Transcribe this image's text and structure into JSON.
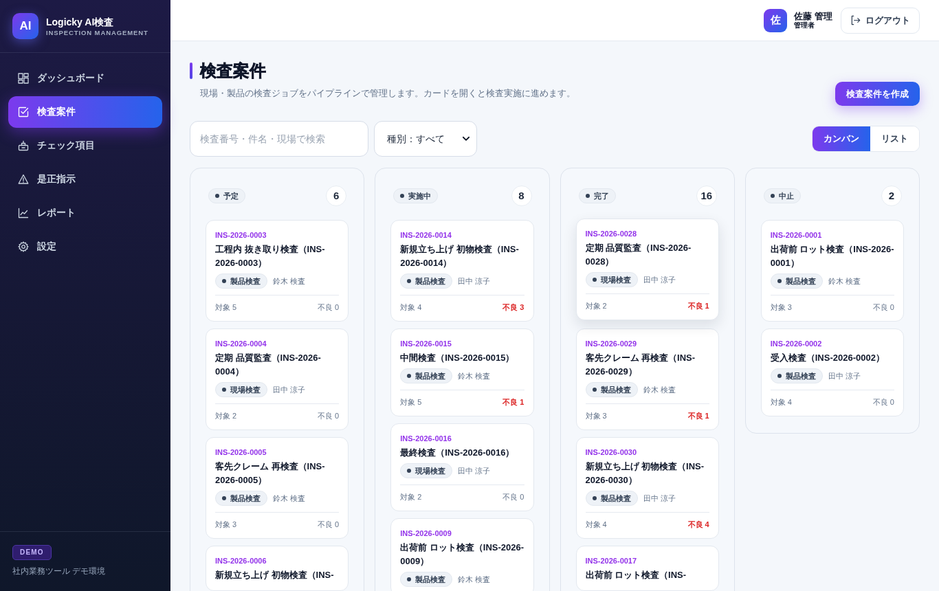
{
  "sidebar": {
    "logo": "AI",
    "title": "Logicky AI検査",
    "subtitle": "INSPECTION MANAGEMENT",
    "items": [
      {
        "label": "ダッシュボード",
        "selected": false
      },
      {
        "label": "検査案件",
        "selected": true
      },
      {
        "label": "チェック項目",
        "selected": false
      },
      {
        "label": "是正指示",
        "selected": false
      },
      {
        "label": "レポート",
        "selected": false
      },
      {
        "label": "設定",
        "selected": false
      }
    ],
    "badge": "DEMO",
    "note": "社内業務ツール デモ環境"
  },
  "header": {
    "user": {
      "avatar": "佐",
      "name": "佐藤 管理",
      "role": "管理者"
    },
    "logout": "ログアウト"
  },
  "page": {
    "title": "検査案件",
    "description": "現場・製品の検査ジョブをパイプラインで管理します。カードを開くと検査実施に進めます。",
    "create_button": "検査案件を作成"
  },
  "filters": {
    "search": {
      "placeholder": "検査番号・件名・現場で検索"
    },
    "type": {
      "value": "種別：すべて"
    }
  },
  "view_toggle": [
    {
      "label": "カンバン",
      "selected": true
    },
    {
      "label": "リスト",
      "selected": false
    }
  ],
  "board": {
    "columns": [
      {
        "status": "予定",
        "count": "6",
        "cards": [
          {
            "id": "INS-2026-0003",
            "title": "工程内 抜き取り検査（INS-2026-0003）",
            "tag": "製品検査",
            "assignee": "鈴木 検査",
            "target": "対象 5",
            "defects": "不良 0",
            "alert": false,
            "hovered": false
          },
          {
            "id": "INS-2026-0004",
            "title": "定期 品質監査（INS-2026-0004）",
            "tag": "現場検査",
            "assignee": "田中 涼子",
            "target": "対象 2",
            "defects": "不良 0",
            "alert": false,
            "hovered": false
          },
          {
            "id": "INS-2026-0005",
            "title": "客先クレーム 再検査（INS-2026-0005）",
            "tag": "製品検査",
            "assignee": "鈴木 検査",
            "target": "対象 3",
            "defects": "不良 0",
            "alert": false,
            "hovered": false
          },
          {
            "id": "INS-2026-0006",
            "title": "新規立ち上げ 初物検査（INS-",
            "hovered": false
          }
        ]
      },
      {
        "status": "実施中",
        "count": "8",
        "cards": [
          {
            "id": "INS-2026-0014",
            "title": "新規立ち上げ 初物検査（INS-2026-0014）",
            "tag": "製品検査",
            "assignee": "田中 涼子",
            "target": "対象 4",
            "defects": "不良 3",
            "alert": true,
            "hovered": false
          },
          {
            "id": "INS-2026-0015",
            "title": "中間検査（INS-2026-0015）",
            "tag": "製品検査",
            "assignee": "鈴木 検査",
            "target": "対象 5",
            "defects": "不良 1",
            "alert": true,
            "hovered": false
          },
          {
            "id": "INS-2026-0016",
            "title": "最終検査（INS-2026-0016）",
            "tag": "現場検査",
            "assignee": "田中 涼子",
            "target": "対象 2",
            "defects": "不良 0",
            "alert": false,
            "hovered": false
          },
          {
            "id": "INS-2026-0009",
            "title": "出荷前 ロット検査（INS-2026-0009）",
            "tag": "製品検査",
            "assignee": "鈴木 検査",
            "hovered": false
          }
        ]
      },
      {
        "status": "完了",
        "count": "16",
        "cards": [
          {
            "id": "INS-2026-0028",
            "title": "定期 品質監査（INS-2026-0028）",
            "tag": "現場検査",
            "assignee": "田中 涼子",
            "target": "対象 2",
            "defects": "不良 1",
            "alert": true,
            "hovered": true
          },
          {
            "id": "INS-2026-0029",
            "title": "客先クレーム 再検査（INS-2026-0029）",
            "tag": "製品検査",
            "assignee": "鈴木 検査",
            "target": "対象 3",
            "defects": "不良 1",
            "alert": true,
            "hovered": false
          },
          {
            "id": "INS-2026-0030",
            "title": "新規立ち上げ 初物検査（INS-2026-0030）",
            "tag": "製品検査",
            "assignee": "田中 涼子",
            "target": "対象 4",
            "defects": "不良 4",
            "alert": true,
            "hovered": false
          },
          {
            "id": "INS-2026-0017",
            "title": "出荷前 ロット検査（INS-",
            "hovered": false
          }
        ]
      },
      {
        "status": "中止",
        "count": "2",
        "cards": [
          {
            "id": "INS-2026-0001",
            "title": "出荷前 ロット検査（INS-2026-0001）",
            "tag": "製品検査",
            "assignee": "鈴木 検査",
            "target": "対象 3",
            "defects": "不良 0",
            "alert": false,
            "hovered": false
          },
          {
            "id": "INS-2026-0002",
            "title": "受入検査（INS-2026-0002）",
            "tag": "製品検査",
            "assignee": "田中 涼子",
            "target": "対象 4",
            "defects": "不良 0",
            "alert": false,
            "hovered": false
          }
        ]
      }
    ]
  }
}
